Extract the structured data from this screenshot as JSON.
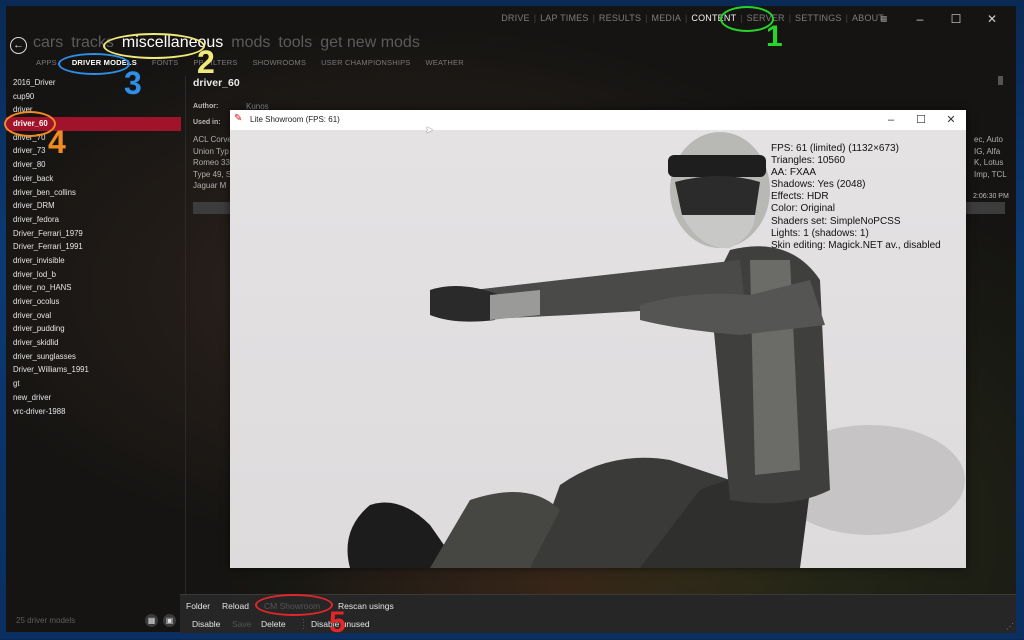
{
  "topnav": {
    "items": [
      "DRIVE",
      "LAP TIMES",
      "RESULTS",
      "MEDIA",
      "CONTENT",
      "SERVER",
      "SETTINGS",
      "ABOUT"
    ],
    "active": "CONTENT"
  },
  "window_controls": {
    "menu": "≡",
    "minimize": "–",
    "maximize": "☐",
    "close": "✕"
  },
  "back_icon": "←",
  "categories": {
    "items": [
      "cars",
      "tracks",
      "miscellaneous",
      "mods",
      "tools",
      "get new mods"
    ],
    "active": "miscellaneous"
  },
  "subtabs": {
    "items": [
      "APPS",
      "DRIVER MODELS",
      "FONTS",
      "PP FILTERS",
      "SHOWROOMS",
      "USER CHAMPIONSHIPS",
      "WEATHER"
    ],
    "active": "DRIVER MODELS"
  },
  "driver_list": {
    "items": [
      "2016_Driver",
      "cup90",
      "driver",
      "driver_60",
      "driver_70",
      "driver_73",
      "driver_80",
      "driver_back",
      "driver_ben_collins",
      "driver_DRM",
      "driver_fedora",
      "Driver_Ferrari_1979",
      "Driver_Ferrari_1991",
      "driver_invisible",
      "driver_lod_b",
      "driver_no_HANS",
      "driver_ocolus",
      "driver_oval",
      "driver_pudding",
      "driver_skidlid",
      "driver_sunglasses",
      "Driver_Williams_1991",
      "gt",
      "new_driver",
      "vrc-driver-1988"
    ],
    "selected": "driver_60",
    "footer": "25 driver models"
  },
  "sidebar_icons": {
    "grid": "▦",
    "save": "💾"
  },
  "detail": {
    "title": "driver_60",
    "author_label": "Author:",
    "author_value": "Kunos",
    "used_in_label": "Used in:",
    "used_in_lines_left": [
      "ACL Corve",
      "Union Typ",
      "Romeo 33",
      "Type 49, S",
      "Jaguar M"
    ],
    "used_in_lines_right": [
      "ec, Auto",
      "IG, Alfa",
      "K, Lotus",
      "Imp, TCL"
    ],
    "timestamp": "2:06:30 PM"
  },
  "bottombar": {
    "row1": [
      "Folder",
      "Reload",
      "CM Showroom",
      "Rescan usings"
    ],
    "row2": [
      "Disable",
      "Save",
      "Delete",
      "Disable unused"
    ]
  },
  "showroom": {
    "title": "Lite Showroom (FPS: 61)",
    "stats": [
      "FPS: 61 (limited) (1132×673)",
      "Triangles: 10560",
      "AA: FXAA",
      "Shadows: Yes (2048)",
      "Effects: HDR",
      "Color: Original",
      "Shaders set: SimpleNoPCSS",
      "Lights: 1 (shadows: 1)",
      "Skin editing: Magick.NET av., disabled"
    ]
  },
  "annotations": [
    "1",
    "2",
    "3",
    "4",
    "5"
  ],
  "colors": {
    "selected_row": "#a0132a",
    "ann1": "#27d42a",
    "ann2": "#f1ea7a",
    "ann3": "#2e8ee8",
    "ann4": "#f08a22",
    "ann5": "#e2262a"
  }
}
